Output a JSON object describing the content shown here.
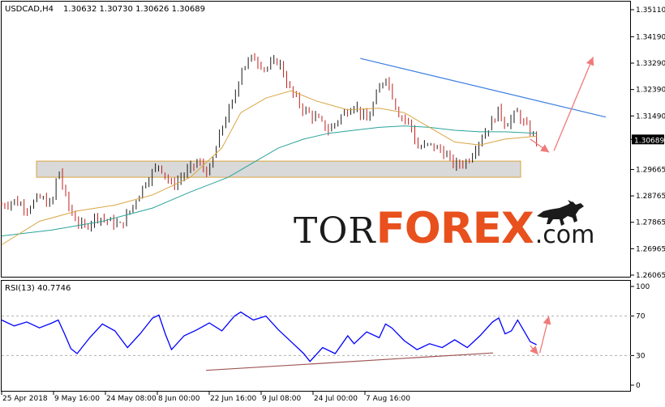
{
  "header": {
    "symbol": "USDCAD,H4",
    "ohlc": "1.30632 1.30730 1.30626 1.30689"
  },
  "rsi_header": "RSI(13) 40.7746",
  "brand": {
    "part1": "TOR",
    "part2": "FOREX",
    "part3": ".com",
    "icon": "bull-icon"
  },
  "colors": {
    "bull_candle": "#1b1b1b",
    "bear_candle": "#c02020",
    "ma_fast": "#d9a441",
    "ma_slow": "#2aa39a",
    "rsi_line": "#0000ff",
    "resistance_line": "#3a7ee0",
    "forecast_arrow": "#f07a7a",
    "support_zone": "#d9d9d9",
    "rsi_trend": "#a05555"
  },
  "chart_data": [
    {
      "type": "candlestick",
      "title": "USDCAD,H4",
      "y_ticks": [
        "1.35110",
        "1.34190",
        "1.33290",
        "1.32390",
        "1.31490",
        "1.30689",
        "1.29665",
        "1.28765",
        "1.27865",
        "1.26965",
        "1.26065"
      ],
      "ylim": [
        1.26065,
        1.3511
      ],
      "current_price": "1.30689",
      "x_ticks": [
        "25 Apr 2018",
        "9 May 16:00",
        "24 May 08:00",
        "8 Jun 00:00",
        "22 Jun 16:00",
        "9 Jul 08:00",
        "24 Jul 00:00",
        "7 Aug 16:00"
      ],
      "price_path": [
        [
          0,
          1.2845
        ],
        [
          0.02,
          1.286
        ],
        [
          0.04,
          1.2835
        ],
        [
          0.06,
          1.287
        ],
        [
          0.08,
          1.2845
        ],
        [
          0.09,
          1.2975
        ],
        [
          0.1,
          1.288
        ],
        [
          0.11,
          1.282
        ],
        [
          0.13,
          1.2765
        ],
        [
          0.15,
          1.281
        ],
        [
          0.17,
          1.279
        ],
        [
          0.19,
          1.2775
        ],
        [
          0.21,
          1.285
        ],
        [
          0.23,
          1.293
        ],
        [
          0.25,
          1.2985
        ],
        [
          0.27,
          1.291
        ],
        [
          0.29,
          1.295
        ],
        [
          0.31,
          1.299
        ],
        [
          0.33,
          1.2955
        ],
        [
          0.35,
          1.311
        ],
        [
          0.37,
          1.321
        ],
        [
          0.38,
          1.331
        ],
        [
          0.4,
          1.335
        ],
        [
          0.42,
          1.331
        ],
        [
          0.44,
          1.334
        ],
        [
          0.45,
          1.328
        ],
        [
          0.46,
          1.323
        ],
        [
          0.48,
          1.317
        ],
        [
          0.5,
          1.314
        ],
        [
          0.52,
          1.31
        ],
        [
          0.54,
          1.315
        ],
        [
          0.56,
          1.319
        ],
        [
          0.58,
          1.313
        ],
        [
          0.6,
          1.324
        ],
        [
          0.61,
          1.329
        ],
        [
          0.63,
          1.316
        ],
        [
          0.65,
          1.312
        ],
        [
          0.66,
          1.304
        ],
        [
          0.68,
          1.305
        ],
        [
          0.7,
          1.303
        ],
        [
          0.72,
          1.298
        ],
        [
          0.74,
          1.2995
        ],
        [
          0.76,
          1.307
        ],
        [
          0.78,
          1.313
        ],
        [
          0.79,
          1.317
        ],
        [
          0.8,
          1.312
        ],
        [
          0.82,
          1.316
        ],
        [
          0.83,
          1.312
        ],
        [
          0.85,
          1.3069
        ]
      ],
      "ma_fast_path": [
        [
          0,
          1.271
        ],
        [
          0.06,
          1.279
        ],
        [
          0.12,
          1.2825
        ],
        [
          0.18,
          1.2845
        ],
        [
          0.24,
          1.288
        ],
        [
          0.3,
          1.294
        ],
        [
          0.35,
          1.304
        ],
        [
          0.38,
          1.316
        ],
        [
          0.42,
          1.321
        ],
        [
          0.46,
          1.3235
        ],
        [
          0.5,
          1.32
        ],
        [
          0.55,
          1.317
        ],
        [
          0.6,
          1.3175
        ],
        [
          0.64,
          1.316
        ],
        [
          0.68,
          1.311
        ],
        [
          0.72,
          1.306
        ],
        [
          0.76,
          1.305
        ],
        [
          0.8,
          1.307
        ],
        [
          0.85,
          1.308
        ]
      ],
      "ma_slow_path": [
        [
          0,
          1.274
        ],
        [
          0.08,
          1.276
        ],
        [
          0.16,
          1.279
        ],
        [
          0.24,
          1.2835
        ],
        [
          0.3,
          1.289
        ],
        [
          0.36,
          1.294
        ],
        [
          0.4,
          1.299
        ],
        [
          0.44,
          1.304
        ],
        [
          0.48,
          1.307
        ],
        [
          0.52,
          1.309
        ],
        [
          0.56,
          1.31
        ],
        [
          0.6,
          1.311
        ],
        [
          0.64,
          1.3115
        ],
        [
          0.68,
          1.311
        ],
        [
          0.72,
          1.31
        ],
        [
          0.76,
          1.3095
        ],
        [
          0.8,
          1.3095
        ],
        [
          0.85,
          1.309
        ]
      ],
      "support_zone": [
        1.294,
        1.2995
      ],
      "resistance_line": [
        [
          0.57,
          1.3345
        ],
        [
          0.96,
          1.3145
        ]
      ],
      "forecast": [
        [
          0.84,
          1.307
        ],
        [
          0.87,
          1.3025
        ],
        [
          0.94,
          1.335
        ]
      ]
    },
    {
      "type": "line",
      "title": "RSI(13) 40.7746",
      "y_ticks": [
        "100",
        "70",
        "30",
        "0"
      ],
      "ylim": [
        0,
        100
      ],
      "value": 40.7746,
      "rsi_path": [
        [
          0,
          66
        ],
        [
          0.02,
          60
        ],
        [
          0.04,
          64
        ],
        [
          0.06,
          58
        ],
        [
          0.08,
          63
        ],
        [
          0.09,
          66
        ],
        [
          0.1,
          52
        ],
        [
          0.11,
          37
        ],
        [
          0.12,
          32
        ],
        [
          0.14,
          48
        ],
        [
          0.16,
          62
        ],
        [
          0.18,
          55
        ],
        [
          0.2,
          38
        ],
        [
          0.22,
          52
        ],
        [
          0.24,
          68
        ],
        [
          0.25,
          71
        ],
        [
          0.26,
          52
        ],
        [
          0.27,
          36
        ],
        [
          0.29,
          50
        ],
        [
          0.31,
          56
        ],
        [
          0.33,
          63
        ],
        [
          0.35,
          55
        ],
        [
          0.37,
          70
        ],
        [
          0.38,
          74
        ],
        [
          0.4,
          66
        ],
        [
          0.42,
          70
        ],
        [
          0.44,
          56
        ],
        [
          0.46,
          44
        ],
        [
          0.48,
          32
        ],
        [
          0.49,
          24
        ],
        [
          0.51,
          38
        ],
        [
          0.53,
          32
        ],
        [
          0.55,
          50
        ],
        [
          0.56,
          42
        ],
        [
          0.58,
          54
        ],
        [
          0.6,
          48
        ],
        [
          0.61,
          62
        ],
        [
          0.62,
          58
        ],
        [
          0.64,
          45
        ],
        [
          0.66,
          36
        ],
        [
          0.68,
          42
        ],
        [
          0.7,
          38
        ],
        [
          0.72,
          46
        ],
        [
          0.74,
          38
        ],
        [
          0.76,
          50
        ],
        [
          0.78,
          64
        ],
        [
          0.79,
          68
        ],
        [
          0.8,
          52
        ],
        [
          0.81,
          55
        ],
        [
          0.82,
          66
        ],
        [
          0.83,
          55
        ],
        [
          0.84,
          44
        ],
        [
          0.85,
          41
        ]
      ],
      "trend_line": [
        [
          0.33,
          15
        ],
        [
          0.74,
          31
        ]
      ],
      "forecast": [
        [
          0.84,
          40
        ],
        [
          0.85,
          31
        ],
        [
          0.88,
          70
        ]
      ]
    }
  ]
}
